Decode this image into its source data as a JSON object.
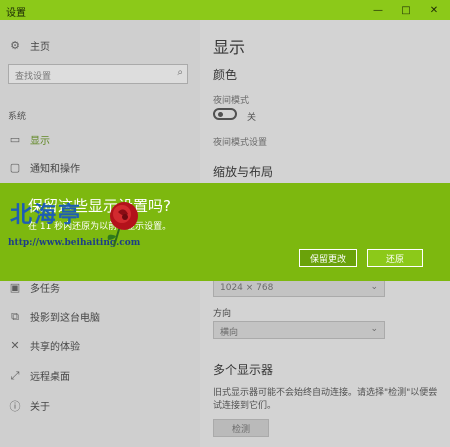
{
  "window": {
    "title": "设置"
  },
  "titlebar_controls": {
    "minimize": "—",
    "maximize": "□",
    "close": "✕"
  },
  "sidebar": {
    "home_label": "主页",
    "search_placeholder": "查找设置",
    "section_label": "系统",
    "items": [
      {
        "label": "显示",
        "icon": "monitor-icon",
        "active": true
      },
      {
        "label": "通知和操作",
        "icon": "chat-icon",
        "active": false
      },
      {
        "label": "多任务",
        "icon": "multitask-icon",
        "active": false
      },
      {
        "label": "投影到这台电脑",
        "icon": "project-icon",
        "active": false
      },
      {
        "label": "共享的体验",
        "icon": "share-icon",
        "active": false
      },
      {
        "label": "远程桌面",
        "icon": "remote-desktop-icon",
        "active": false
      },
      {
        "label": "关于",
        "icon": "info-icon",
        "active": false
      }
    ]
  },
  "content": {
    "title": "显示",
    "color_heading": "颜色",
    "night_mode_label": "夜间模式",
    "night_mode_state": "关",
    "night_mode_settings": "夜间模式设置",
    "scale_heading": "缩放与布局",
    "resolution_value": "1024 × 768",
    "orientation_label": "方向",
    "orientation_value": "横向",
    "multi_display_heading": "多个显示器",
    "multi_display_text": "旧式显示器可能不会始终自动连接。请选择\"检测\"以便尝试连接到它们。",
    "detect_button": "检测"
  },
  "dialog": {
    "question": "保留这些显示设置吗?",
    "countdown_text": "在 11 秒内还原为以前的显示设置。",
    "keep_button": "保留更改",
    "revert_button": "还原",
    "accent_color": "#7db80f"
  },
  "watermark": {
    "text": "北海亭",
    "url": "http://www.beihaiting.com"
  }
}
